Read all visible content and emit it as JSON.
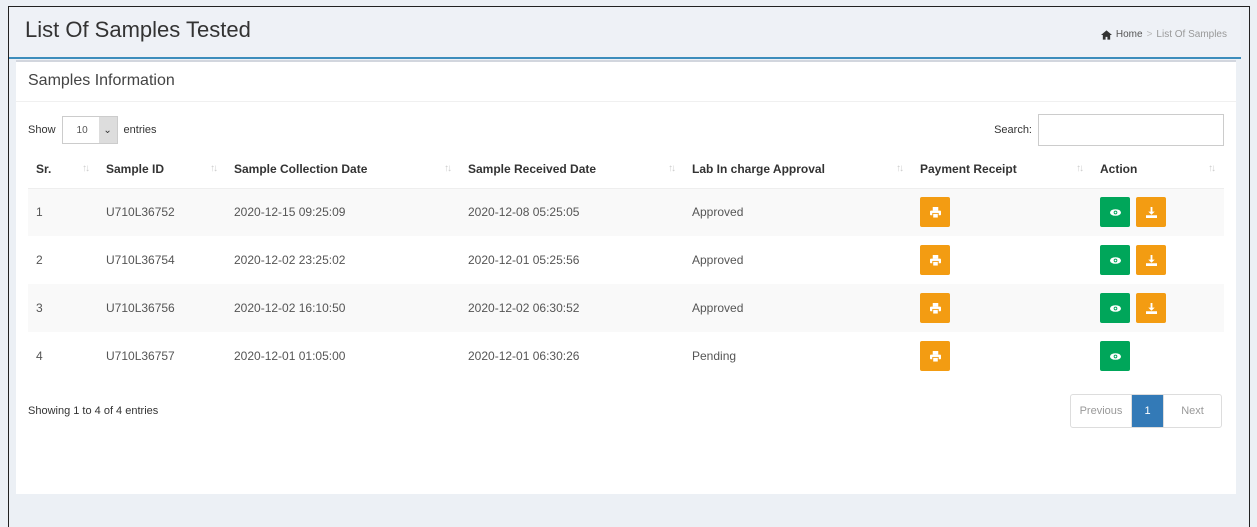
{
  "header": {
    "title": "List Of Samples Tested",
    "breadcrumb": {
      "home": "Home",
      "current": "List Of Samples"
    }
  },
  "box": {
    "title": "Samples Information"
  },
  "controls": {
    "show_label": "Show",
    "entries_value": "10",
    "entries_label": "entries",
    "search_label": "Search:",
    "search_value": ""
  },
  "table": {
    "columns": [
      "Sr.",
      "Sample ID",
      "Sample Collection Date",
      "Sample Received Date",
      "Lab In charge Approval",
      "Payment Receipt",
      "Action"
    ],
    "rows": [
      {
        "sr": "1",
        "sample_id": "U710L36752",
        "collection": "2020-12-15 09:25:09",
        "received": "2020-12-08 05:25:05",
        "approval": "Approved",
        "download": true
      },
      {
        "sr": "2",
        "sample_id": "U710L36754",
        "collection": "2020-12-02 23:25:02",
        "received": "2020-12-01 05:25:56",
        "approval": "Approved",
        "download": true
      },
      {
        "sr": "3",
        "sample_id": "U710L36756",
        "collection": "2020-12-02 16:10:50",
        "received": "2020-12-02 06:30:52",
        "approval": "Approved",
        "download": true
      },
      {
        "sr": "4",
        "sample_id": "U710L36757",
        "collection": "2020-12-01 01:05:00",
        "received": "2020-12-01 06:30:26",
        "approval": "Pending",
        "download": false
      }
    ]
  },
  "footer": {
    "info": "Showing 1 to 4 of 4 entries",
    "pagination": {
      "previous": "Previous",
      "current": "1",
      "next": "Next"
    }
  },
  "icons": {
    "print": "print-icon",
    "view": "eye-icon",
    "download": "download-icon",
    "home": "home-icon"
  },
  "colors": {
    "accent": "#3c8dbc",
    "warning": "#f39c12",
    "success": "#00a65a",
    "page_active": "#337ab7"
  }
}
